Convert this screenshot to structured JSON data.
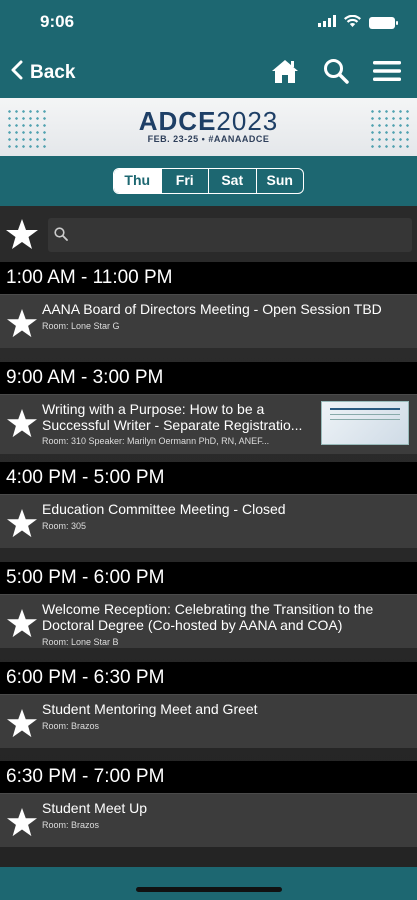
{
  "status_bar": {
    "time": "9:06"
  },
  "nav": {
    "back_label": "Back"
  },
  "banner": {
    "title_main": "ADCE",
    "title_year": "2023",
    "subtitle": "FEB. 23-25 • #AANAADCE"
  },
  "days": [
    "Thu",
    "Fri",
    "Sat",
    "Sun"
  ],
  "selected_day": "Thu",
  "sessions": [
    {
      "time": "1:00 AM - 11:00 PM",
      "title": "AANA Board of Directors Meeting  - Open Session TBD",
      "room": "Room: Lone Star G"
    },
    {
      "time": "9:00 AM - 3:00 PM",
      "title": "Writing with a Purpose:  How to be a Successful Writer - Separate Registratio...",
      "room": "Room: 310 Speaker: Marilyn Oermann PhD, RN, ANEF..."
    },
    {
      "time": "4:00 PM - 5:00 PM",
      "title": "Education Committee Meeting - Closed",
      "room": "Room: 305"
    },
    {
      "time": "5:00 PM - 6:00 PM",
      "title": "Welcome Reception: Celebrating the Transition to the Doctoral Degree (Co-hosted by AANA and COA)",
      "room": "Room: Lone Star B"
    },
    {
      "time": "6:00 PM - 6:30 PM",
      "title": "Student Mentoring Meet and Greet",
      "room": "Room: Brazos"
    },
    {
      "time": "6:30 PM - 7:00 PM",
      "title": "Student Meet Up",
      "room": "Room: Brazos"
    }
  ],
  "colors": {
    "teal": "#1d6771",
    "header_black": "#000000",
    "row_gray": "#3c3c3c"
  }
}
